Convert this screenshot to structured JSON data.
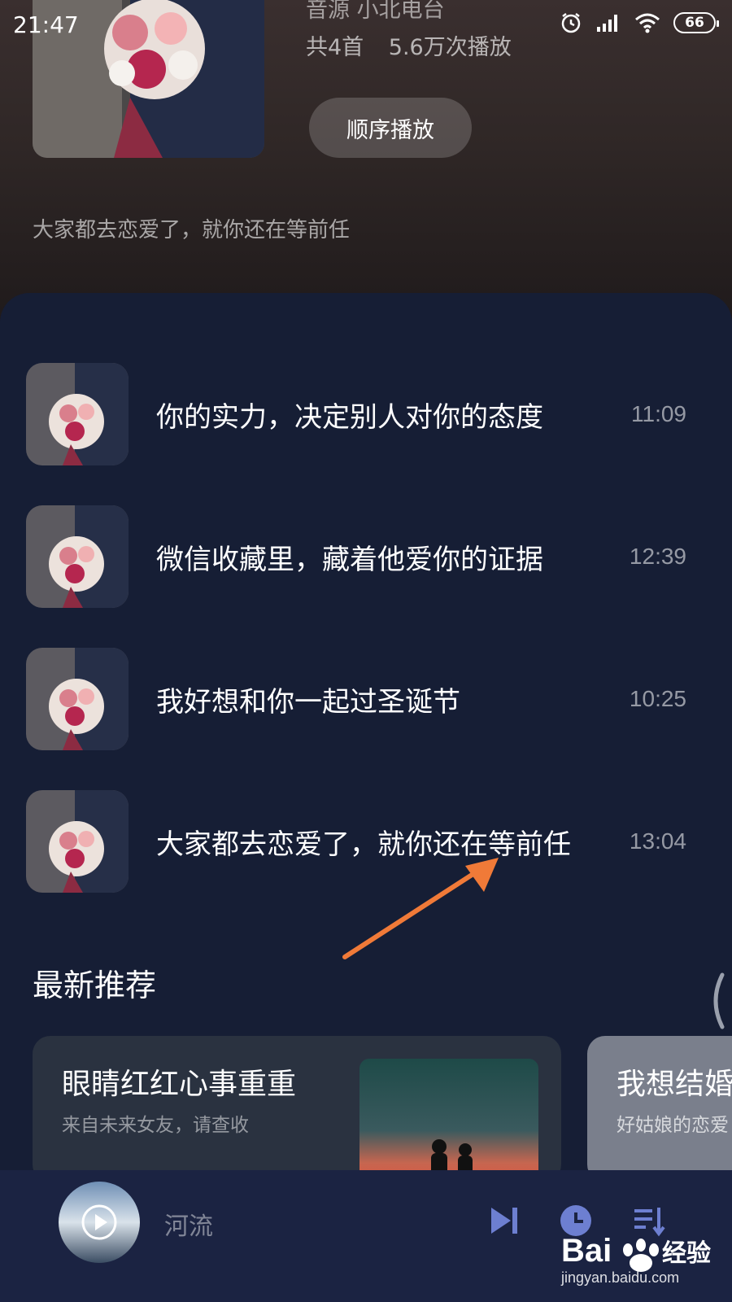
{
  "status": {
    "time": "21:47",
    "battery": "66"
  },
  "album": {
    "source": "音源  小北电台",
    "count": "共4首",
    "plays": "5.6万次播放",
    "play_button": "顺序播放",
    "description": "大家都去恋爱了，就你还在等前任"
  },
  "tracks": [
    {
      "title": "你的实力，决定别人对你的态度",
      "duration": "11:09"
    },
    {
      "title": "微信收藏里，藏着他爱你的证据",
      "duration": "12:39"
    },
    {
      "title": "我好想和你一起过圣诞节",
      "duration": "10:25"
    },
    {
      "title": "大家都去恋爱了，就你还在等前任",
      "duration": "13:04"
    }
  ],
  "recommend": {
    "section_title": "最新推荐",
    "cards": [
      {
        "title": "眼睛红红心事重重",
        "subtitle": "来自未来女友，请查收"
      },
      {
        "title": "我想结婚",
        "subtitle": "好姑娘的恋爱"
      }
    ]
  },
  "player": {
    "current_title": "河流",
    "icons": [
      "play-icon",
      "next-icon",
      "timer-icon",
      "playlist-icon"
    ]
  },
  "watermark": {
    "text": "jingyan.baidu.com"
  },
  "colors": {
    "panel": "#161e35",
    "player_bar": "#1b2342",
    "arrow": "#f07a38"
  }
}
